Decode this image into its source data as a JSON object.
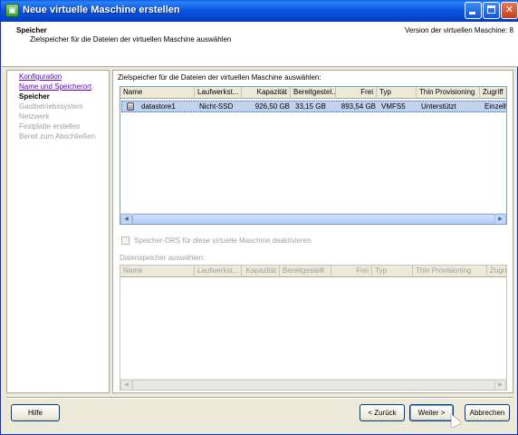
{
  "window": {
    "title": "Neue virtuelle Maschine erstellen"
  },
  "header": {
    "title": "Speicher",
    "subtitle": "Zielspeicher für die Dateien der virtuellen Maschine auswählen",
    "version": "Version der virtuellen Maschine: 8"
  },
  "nav": {
    "items": [
      {
        "label": "Konfiguration",
        "state": "link"
      },
      {
        "label": "Name und Speicherort",
        "state": "link"
      },
      {
        "label": "Speicher",
        "state": "current"
      },
      {
        "label": "Gastbetriebssystem",
        "state": "disabled"
      },
      {
        "label": "Netzwerk",
        "state": "disabled"
      },
      {
        "label": "Festplatte erstellen",
        "state": "disabled"
      },
      {
        "label": "Bereit zum Abschließen",
        "state": "disabled"
      }
    ]
  },
  "main": {
    "label": "Zielspeicher für die Dateien der virtuellen Maschine auswählen:",
    "table": {
      "columns": [
        "Name",
        "Laufwerkst...",
        "Kapazität",
        "Bereitgestel...",
        "Frei",
        "Typ",
        "Thin Provisioning",
        "Zugriff"
      ],
      "rows": [
        {
          "name": "datastore1",
          "drive_type": "Nicht-SSD",
          "capacity": "926,50 GB",
          "provisioned": "33,15 GB",
          "free": "893,54 GB",
          "type": "VMFS5",
          "thin_provisioning": "Unterstützt",
          "access": "Einzelhost"
        }
      ]
    },
    "drs_checkbox": {
      "label": "Speicher-DRS für diese virtuelle Maschine deaktivieren",
      "checked": false,
      "enabled": false
    },
    "datastore_label": "Datenspeicher auswählen:",
    "table2": {
      "columns": [
        "Name",
        "Laufwerkst...",
        "Kapazität",
        "Bereitgestellt",
        "Frei",
        "Typ",
        "Thin Provisioning",
        "Zugriff"
      ]
    }
  },
  "footer": {
    "help": "Hilfe",
    "back": "< Zurück",
    "next": "Weiter >",
    "cancel": "Abbrechen"
  },
  "icons": {
    "app": "vm-wizard-icon",
    "datastore": "datastore-icon"
  }
}
